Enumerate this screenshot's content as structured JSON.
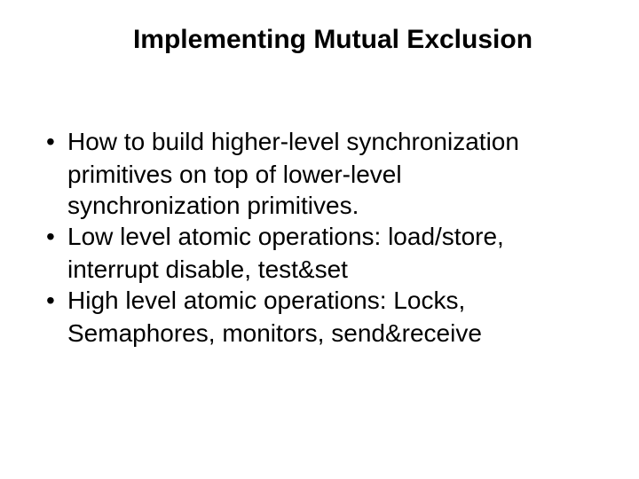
{
  "slide": {
    "title": "Implementing Mutual Exclusion",
    "bullets": [
      {
        "lines": [
          "How to build higher-level synchronization",
          "primitives on top of lower-level",
          "synchronization primitives."
        ]
      },
      {
        "lines": [
          "Low level atomic operations: load/store,",
          "interrupt disable,  test&set"
        ]
      },
      {
        "lines": [
          "High level atomic operations: Locks,",
          "Semaphores, monitors, send&receive"
        ]
      }
    ]
  }
}
